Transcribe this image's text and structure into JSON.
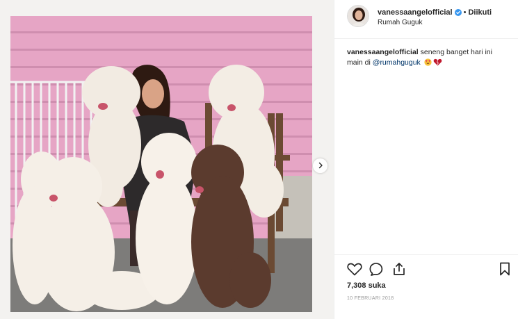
{
  "post": {
    "username": "vanessaangelofficial",
    "verified": true,
    "separator": "•",
    "follow_status": "Diikuti",
    "location": "Rumah Guguk",
    "caption": {
      "username": "vanessaangelofficial",
      "text": "seneng banget hari ini main di",
      "mention": "@rumahguguk"
    },
    "likes": "7,308 suka",
    "date": "10 FEBRUARI 2018"
  },
  "icons": {
    "verified": "verified-badge-icon",
    "like": "heart-icon",
    "comment": "comment-icon",
    "share": "share-icon",
    "save": "bookmark-icon",
    "next": "chevron-right-icon",
    "emoji_1": "smiling-face-with-heart-eyes-emoji",
    "emoji_2": "heart-emoji"
  },
  "photo": {
    "subjects": [
      "woman",
      "white poodle",
      "white poodle",
      "white poodle",
      "white poodle",
      "white poodle",
      "brown poodle"
    ]
  },
  "colors": {
    "verified": "#3897f0",
    "mention": "#003569",
    "wall": "#e8a6c6",
    "date": "#999999"
  }
}
